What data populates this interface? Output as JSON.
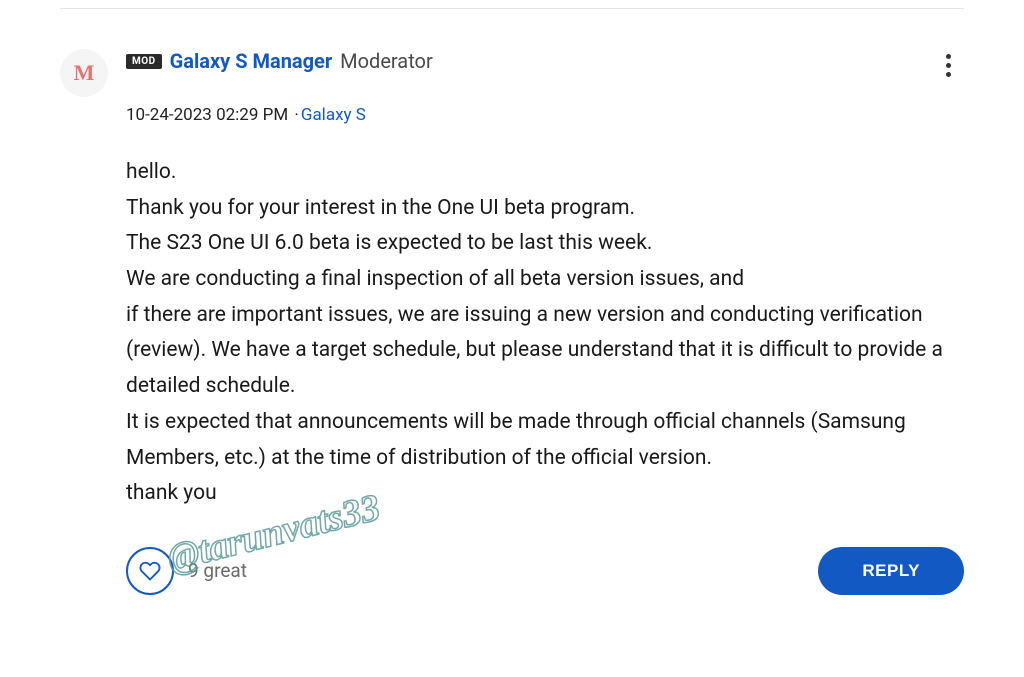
{
  "post": {
    "avatarLetter": "M",
    "modBadge": "MOD",
    "username": "Galaxy S Manager",
    "role": "Moderator",
    "date": "10-24-2023",
    "time": "02:29 PM",
    "category": "Galaxy S",
    "body": {
      "line1": "hello.",
      "line2": "Thank you for your interest in the One UI beta program.",
      "line3": "The S23 One UI 6.0 beta is expected to be last this week.",
      "line4": "We are conducting a final inspection of all beta version issues, and",
      "line5": "if there are important issues, we are issuing a new version and conducting verification (review). We have a target schedule, but please understand that it is difficult to provide a detailed schedule.",
      "line6": "It is expected that announcements will be made through official channels (Samsung Members, etc.) at the time of distribution of the official version.",
      "line7": "thank you"
    },
    "likes": {
      "count": "9",
      "label": "great"
    },
    "replyLabel": "REPLY"
  },
  "watermark": "@tarunvats33"
}
